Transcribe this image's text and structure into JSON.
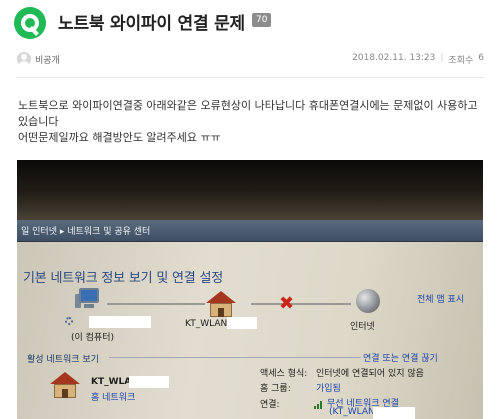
{
  "post": {
    "title": "노트북 와이파이 연결 문제",
    "badge": "70",
    "author": "비공개",
    "date": "2018.02.11. 13:23",
    "separator": "|",
    "views_label": "조회수",
    "views": "6",
    "body_lines": [
      "노트북으로 와이파이연결중 아래와같은 오류현상이 나타납니다 휴대폰연결시에는 문제없이 사용하고있습니다",
      "어떤문제일까요 해결방안도 알려주세요 ㅠㅠ"
    ]
  },
  "screenshot": {
    "breadcrumb": "일 인터넷 ▸ 네트워크 및 공유 센터",
    "heading": "기본 네트워크 정보 보기 및 연결 설정",
    "full_map": "전체 맵 표시",
    "this_computer": "(이 컴퓨터)",
    "router_name": "KT_WLAN",
    "internet": "인터넷",
    "active_networks": "활성 네트워크 보기",
    "connect_or_disconnect": "연결 또는 연결 끊기",
    "network_name": "KT_WLAN",
    "network_type": "홈 네트워크",
    "access_type_label": "액세스 형식:",
    "access_type_value": "인터넷에 연결되어 있지 않음",
    "homegroup_label": "홈 그룹:",
    "homegroup_value": "가입됨",
    "connection_label": "연결:",
    "connection_value": "무선 네트워크 연결",
    "connection_ssid": "(KT_WLAN"
  },
  "colors": {
    "brand_green": "#1fb955",
    "badge_gray": "#8c8c8c",
    "link_blue": "#1e46a8",
    "error_red": "#c8261d"
  },
  "icons": [
    "q-logo-icon",
    "avatar-icon",
    "computer-icon",
    "house-icon",
    "disconnected-x-icon",
    "globe-icon",
    "wifi-signal-icon"
  ]
}
